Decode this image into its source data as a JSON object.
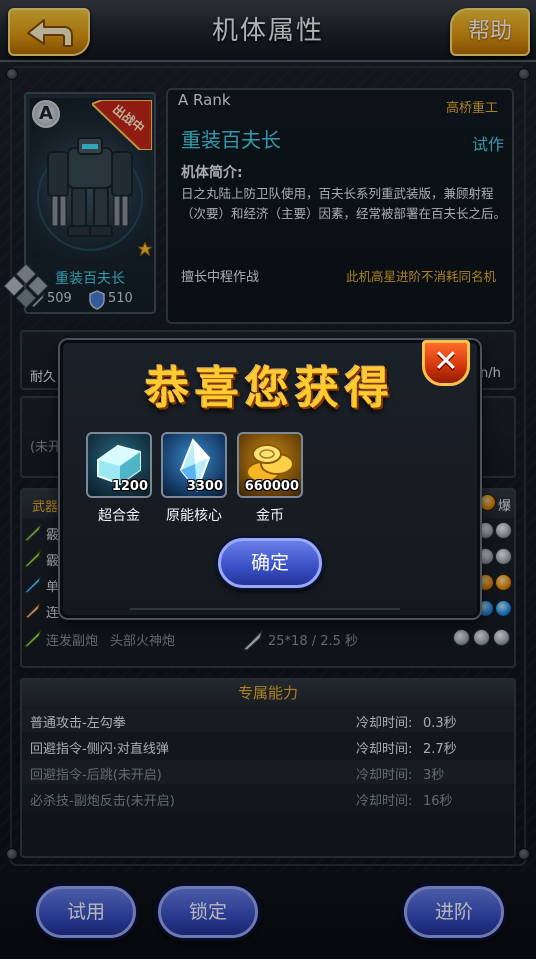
{
  "header": {
    "title": "机体属性",
    "help_label": "帮助"
  },
  "unit_card": {
    "rank_badge": "A",
    "deploy_tag": "出战中",
    "name": "重装百夫长",
    "stat_attack": "509",
    "stat_defense": "510"
  },
  "info": {
    "rank": "A Rank",
    "maker": "高桥重工",
    "title": "重装百夫长",
    "trial_label": "试作",
    "intro_label": "机体简介:",
    "intro_text": "日之丸陆上防卫队使用，百夫长系列重武装版，兼顾射程（次要）和经济（主要）因素，经常被部署在百夫长之后。",
    "skill": "擅长中程作战",
    "note": "此机高星进阶不消耗同名机"
  },
  "background_rows": {
    "stat_label": "耐久",
    "stat_unit": "n/h",
    "locked_label": "(未开",
    "weapons_label": "武器",
    "explode_label": "爆",
    "weapon_rows": [
      {
        "name": "霰"
      },
      {
        "name": "霰"
      },
      {
        "name": "单"
      },
      {
        "name": "连"
      }
    ],
    "last_weapon": {
      "name": "连发副炮",
      "mount": "头部火神炮",
      "stats": "25*18 / 2.5 秒"
    }
  },
  "abilities": {
    "header": "专属能力",
    "rows": [
      {
        "name": "普通攻击-左勾拳",
        "cooldown_label": "冷却时间:",
        "cooldown": "0.3秒"
      },
      {
        "name": "回避指令-侧闪·对直线弹",
        "cooldown_label": "冷却时间:",
        "cooldown": "2.7秒"
      },
      {
        "name": "回避指令-后跳(未开启)",
        "cooldown_label": "冷却时间:",
        "cooldown": "3秒"
      },
      {
        "name": "必杀技-副炮反击(未开启)",
        "cooldown_label": "冷却时间:",
        "cooldown": "16秒"
      }
    ]
  },
  "popup": {
    "title": "恭喜您获得",
    "rewards": [
      {
        "count": "1200",
        "label": "超合金",
        "icon": "super-alloy-icon"
      },
      {
        "count": "3300",
        "label": "原能核心",
        "icon": "energy-core-icon"
      },
      {
        "count": "660000",
        "label": "金币",
        "icon": "gold-coin-icon"
      }
    ],
    "confirm_label": "确定"
  },
  "bottom_buttons": {
    "trial": "试用",
    "lock": "锁定",
    "upgrade": "进阶"
  },
  "colors": {
    "accent_cyan": "#46d4ec",
    "accent_gold": "#f0b42c",
    "button_blue": "#3d53c8",
    "header_gold": "#e29a11"
  }
}
